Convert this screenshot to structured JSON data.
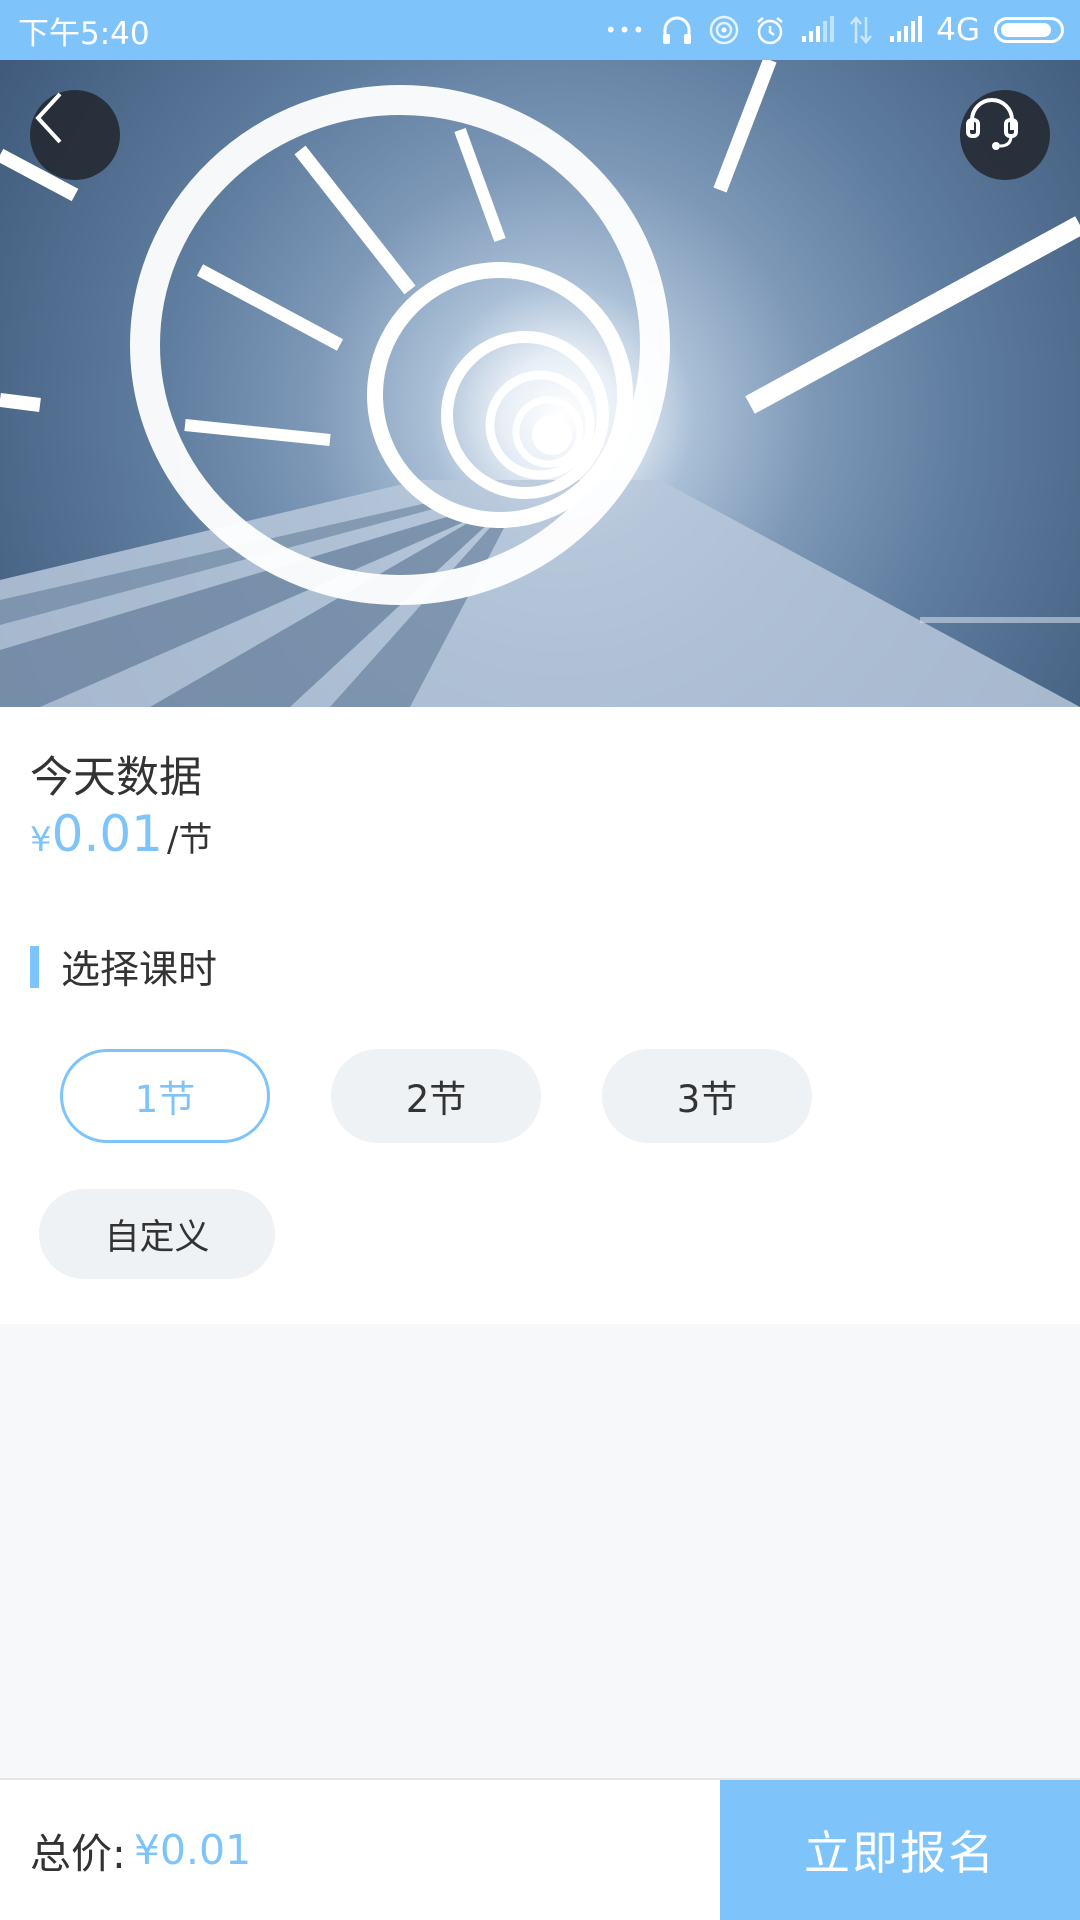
{
  "status_bar": {
    "time": "下午5:40",
    "dots": "•••",
    "network": "4G",
    "icons": [
      "headphones-icon",
      "hotspot-icon",
      "alarm-icon",
      "signal-icon",
      "data-arrows-icon",
      "signal-icon",
      "battery-icon"
    ]
  },
  "hero": {
    "back_icon": "chevron-left-icon",
    "support_icon": "headset-icon"
  },
  "course": {
    "title": "今天数据",
    "price_currency": "¥",
    "price_amount": "0.01",
    "price_unit": "/节"
  },
  "section": {
    "title": "选择课时"
  },
  "options": [
    {
      "label": "1节",
      "selected": true
    },
    {
      "label": "2节",
      "selected": false
    },
    {
      "label": "3节",
      "selected": false
    },
    {
      "label": "自定义",
      "selected": false
    }
  ],
  "footer": {
    "total_label": "总价:",
    "total_value": "¥0.01",
    "enroll_label": "立即报名"
  },
  "colors": {
    "accent": "#7ec4fb",
    "pill_bg": "#eff2f5",
    "page_bg": "#f7f8f9"
  }
}
